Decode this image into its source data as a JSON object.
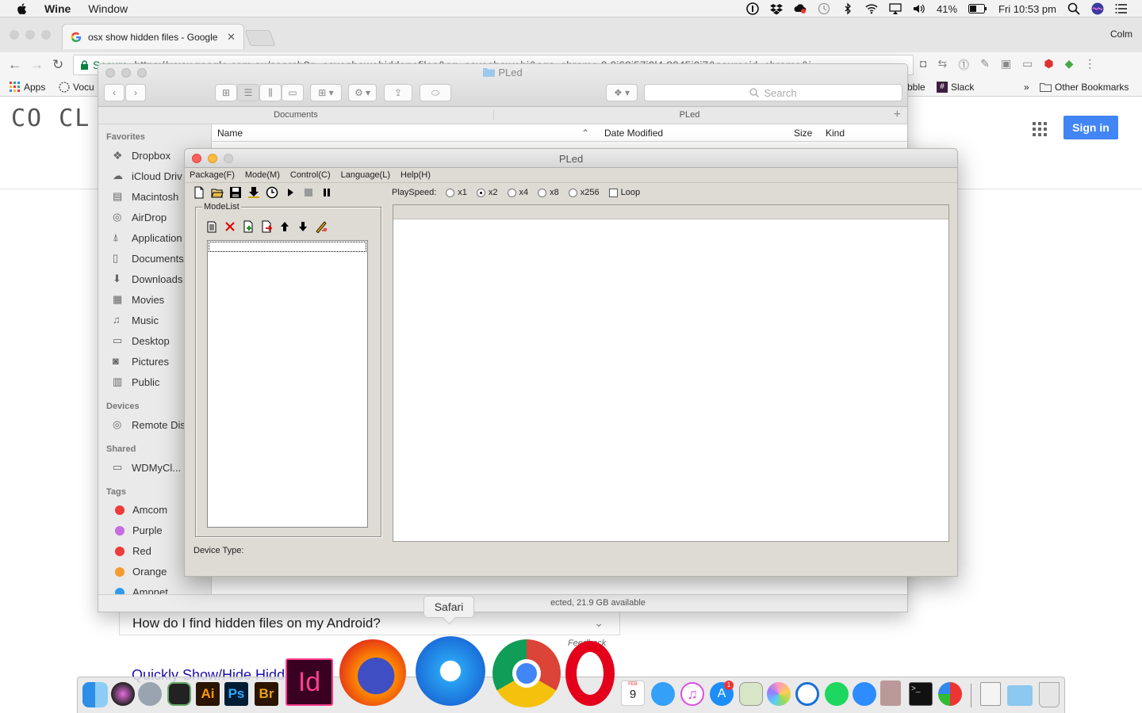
{
  "menubar": {
    "app_name": "Wine",
    "items": [
      "Window"
    ],
    "battery": "41%",
    "clock": "Fri 10:53 pm"
  },
  "chrome": {
    "tab_title": "osx show hidden files - Googlе",
    "user": "Colm",
    "secure_label": "Secure",
    "url": "https://www.google.com.au/search?q=osx+show+hidden+files&oq=osx+show+hi&aqs=chrome.0.0i69i57j0l4.8045j0j7&sourceid=chrome&i",
    "bookmarks": {
      "apps": "Apps",
      "vocab": "Vocu",
      "ble": "bble",
      "slack": "Slack",
      "more": "»",
      "other": "Other Bookmarks"
    },
    "signin": "Sign in",
    "logo_text": "CO  CL",
    "paa_question": "How do I find hidden files on my Android?",
    "feedback": "Feedback",
    "result_link": "Quickly Show/Hide Hidd"
  },
  "finder": {
    "title": "PLed",
    "search_placeholder": "Search",
    "path_left": "Documents",
    "path_right": "PLed",
    "columns": {
      "name": "Name",
      "date": "Date Modified",
      "size": "Size",
      "kind": "Kind"
    },
    "status": "ected, 21.9 GB available",
    "sections": {
      "favorites": "Favorites",
      "devices": "Devices",
      "shared": "Shared",
      "tags": "Tags"
    },
    "favorites": [
      "Dropbox",
      "iCloud Driv",
      "Macintosh",
      "AirDrop",
      "Application",
      "Documents",
      "Downloads",
      "Movies",
      "Music",
      "Desktop",
      "Pictures",
      "Public"
    ],
    "devices": [
      "Remote Dis"
    ],
    "shared": [
      "WDMyCl..."
    ],
    "tags": [
      {
        "label": "Amcom",
        "color": "#ee3b3b"
      },
      {
        "label": "Purple",
        "color": "#c86be0"
      },
      {
        "label": "Red",
        "color": "#ee3b3b"
      },
      {
        "label": "Orange",
        "color": "#f59a2e"
      },
      {
        "label": "Ampnet",
        "color": "#2d9bf0"
      }
    ]
  },
  "pled": {
    "title": "PLed",
    "menu": [
      "Package(F)",
      "Mode(M)",
      "Control(C)",
      "Language(L)",
      "Help(H)"
    ],
    "playspeed_label": "PlaySpeed:",
    "speeds": [
      {
        "label": "x1",
        "selected": false
      },
      {
        "label": "x2",
        "selected": true
      },
      {
        "label": "x4",
        "selected": false
      },
      {
        "label": "x8",
        "selected": false
      },
      {
        "label": "x256",
        "selected": false
      }
    ],
    "loop_label": "Loop",
    "loop_checked": false,
    "modelist_label": "ModeList",
    "device_type_label": "Device Type:"
  },
  "dock": {
    "tooltip": "Safari",
    "calendar_month": "FEB",
    "calendar_day": "9",
    "appstore_badge": "1"
  }
}
